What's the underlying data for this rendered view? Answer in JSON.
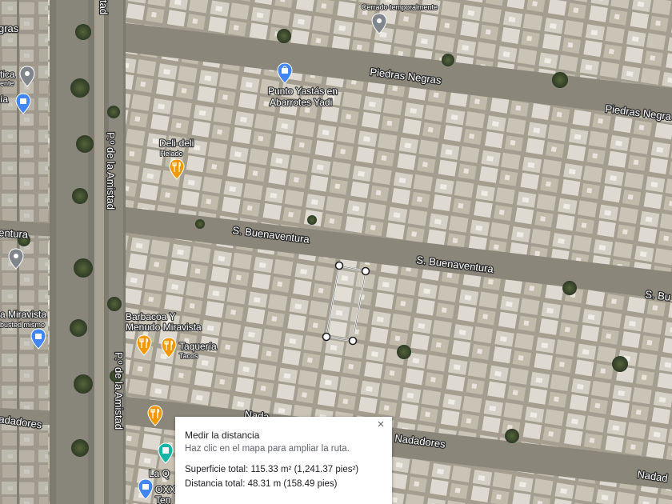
{
  "roads": {
    "piedras_negras_1": "Piedras Negras",
    "piedras_negras_2": "Piedras Negra",
    "buenaventura_1": "S. Buenaventura",
    "buenaventura_2": "S. Buenaventura",
    "buenaventura_3": "S. Bu",
    "amistad_1": "P.º de la Amistad",
    "amistad_2": "P.º de la Amistad",
    "amistad_top": "tad",
    "nadadores_1": "adadores",
    "nadadores_2": "Nadadores",
    "nadadores_3": "Nadad",
    "nadadores_4": "Nada",
    "ventura_left": "entura",
    "negras_left": "gras"
  },
  "pois": {
    "cerrado": "Cerrado temporalmente",
    "punto_yastas_1": "Punto Yastás en",
    "punto_yastas_2": "Abarrotes Yadi",
    "deli_name": "Deli-deli",
    "deli_sub": "Helado",
    "barbacoa_1": "Barbacoa Y",
    "barbacoa_2": "Menudo Miravista",
    "taqueria_name": "Taquería",
    "taqueria_sub": "Tacos",
    "miravista_left": "a Miravista",
    "miravista_sub": "busted mismo",
    "tica": "tica",
    "tica_sub": "ente",
    "ia_left": "ía",
    "la_q": "La Q",
    "oxxo": "OXX",
    "ten": "Ten"
  },
  "measure": {
    "title": "Medir la distancia",
    "hint": "Haz clic en el mapa para ampliar la ruta.",
    "area": "Superficie total: 115.33 m² (1,241.37 pies²)",
    "distance": "Distancia total: 48.31 m (158.49 pies)",
    "close": "×"
  },
  "icons": {
    "restaurant": "fork-knife-icon",
    "shopping": "shopping-bag-icon",
    "generic": "map-pin-icon",
    "transit": "bus-icon"
  },
  "colors": {
    "restaurant_pin": "#f29900",
    "shopping_pin": "#4285f4",
    "grey_pin": "#80868b",
    "transit_pin": "#12b5a6"
  }
}
